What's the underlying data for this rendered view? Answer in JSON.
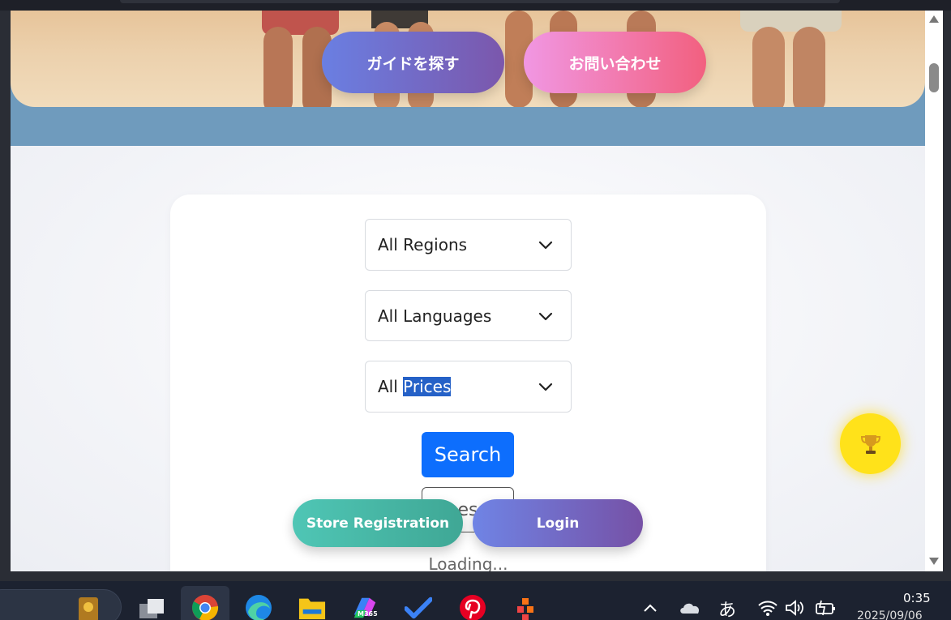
{
  "hero": {
    "find_guide_label": "ガイドを探す",
    "contact_label": "お問い合わせ"
  },
  "search_form": {
    "region_select": {
      "selected": "All Regions"
    },
    "language_select": {
      "selected": "All Languages"
    },
    "price_select": {
      "selected_prefix": "All",
      "selected_highlight": "Prices"
    },
    "search_button_label": "Search",
    "reset_button_label": "es",
    "loading_text": "Loading..."
  },
  "floating_actions": {
    "store_registration_label": "Store Registration",
    "login_label": "Login",
    "trophy_icon": "trophy-icon"
  },
  "taskbar": {
    "apps": [
      "file-explorer-card-icon",
      "task-view-icon",
      "chrome-icon",
      "edge-icon",
      "file-explorer-icon",
      "m365-icon",
      "todo-icon",
      "pinterest-icon",
      "app-icon"
    ],
    "m365_label": "M365",
    "tray": {
      "ime_label": "あ",
      "time": "0:35",
      "date": "2025/09/06"
    }
  },
  "colors": {
    "primary_blue": "#0d6efd",
    "trophy_yellow": "#ffe21a",
    "hero_band": "#6f9bbd"
  }
}
